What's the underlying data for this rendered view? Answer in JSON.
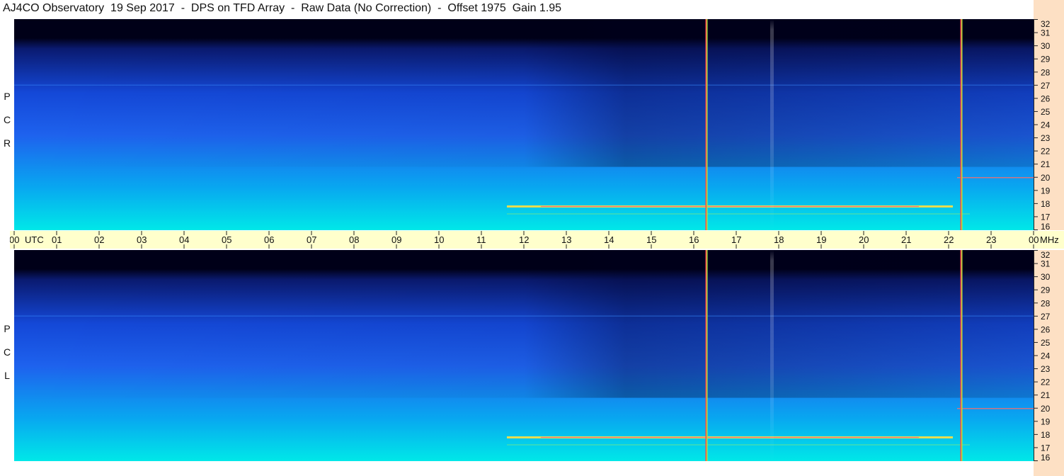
{
  "title": "AJ4CO Observatory  19 Sep 2017  -  DPS on TFD Array  -  Raw Data (No Correction)  -  Offset 1975  Gain 1.95",
  "chart_data": {
    "type": "heatmap",
    "title": "AJ4CO Observatory  19 Sep 2017  -  DPS on TFD Array  -  Raw Data (No Correction)  -  Offset 1975  Gain 1.95",
    "x_axis": {
      "unit_label": "UTC",
      "tick_labels": [
        "00",
        "01",
        "02",
        "03",
        "04",
        "05",
        "06",
        "07",
        "08",
        "09",
        "10",
        "11",
        "12",
        "13",
        "14",
        "15",
        "16",
        "17",
        "18",
        "19",
        "20",
        "21",
        "22",
        "23",
        "00"
      ],
      "range_hours": [
        0,
        24
      ]
    },
    "y_axis": {
      "unit_label": "MHz",
      "range_mhz": [
        16,
        32
      ],
      "tick_labels": [
        "32",
        "31",
        "30",
        "29",
        "28",
        "27",
        "26",
        "25",
        "24",
        "23",
        "22",
        "21",
        "20",
        "19",
        "18",
        "17",
        "16"
      ]
    },
    "panels": [
      {
        "polarization": [
          "R",
          "C",
          "P"
        ]
      },
      {
        "polarization": [
          "L",
          "C",
          "P"
        ]
      }
    ],
    "colors": {
      "low": "#000018",
      "mid": "#1e62ee",
      "high": "#00e8e8",
      "burst": "#ffe040"
    },
    "features": {
      "vertical_lines_utc": [
        16.3,
        22.3
      ],
      "band_interference_mhz": [
        17.8,
        27.0,
        20.0
      ]
    }
  }
}
